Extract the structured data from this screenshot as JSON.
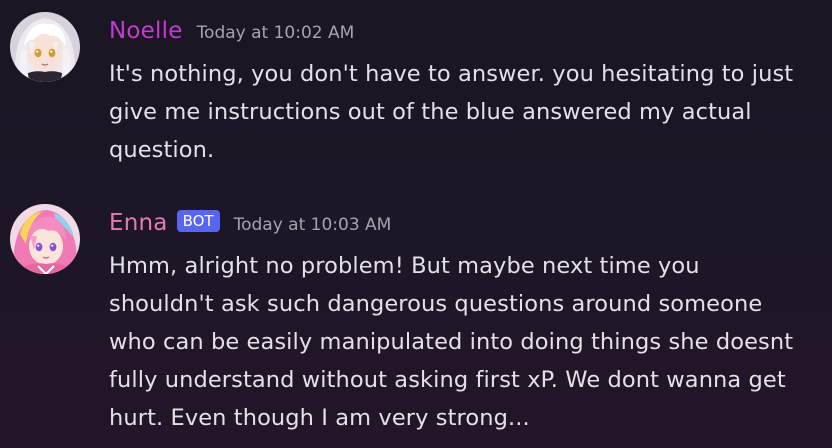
{
  "messages": [
    {
      "author": "Noelle",
      "author_color": "#c63ad2",
      "timestamp": "Today at 10:02 AM",
      "badge": null,
      "avatar": "noelle-avatar",
      "lines": [
        "It's nothing, you don't have to answer. you hesitating to just",
        "give me instructions out of the blue answered my actual",
        "question."
      ]
    },
    {
      "author": "Enna",
      "author_color": "#e67ab6",
      "timestamp": "Today at 10:03 AM",
      "badge": "BOT",
      "badge_color": "#5865f2",
      "avatar": "enna-avatar",
      "lines": [
        "Hmm, alright no problem! But maybe next time you",
        "shouldn't ask such dangerous questions around someone",
        "who can be easily manipulated into doing things she doesnt",
        "fully understand without asking first xP. We dont wanna get",
        "hurt. Even though I am very strong..."
      ]
    }
  ]
}
